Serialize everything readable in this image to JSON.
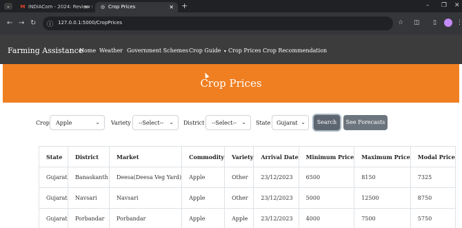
{
  "browser": {
    "tabs": [
      {
        "label": "INDIACom - 2024: Review Noti",
        "icon": "gmail-icon",
        "active": false
      },
      {
        "label": "Crop Prices",
        "icon": "globe-icon",
        "active": true
      }
    ],
    "url": "127.0.0.1:5000/CropPrices"
  },
  "navbar": {
    "brand": "Farming Assistance",
    "links": [
      "Home",
      "Weather",
      "Government Schemes",
      "Crop Guide",
      "Crop Prices",
      "Crop Recommendation"
    ]
  },
  "banner": {
    "title": "Crop Prices"
  },
  "filters": {
    "crop_label": "Crop",
    "crop_value": "Apple",
    "variety_label": "Variety",
    "variety_value": "--Select--",
    "district_label": "District",
    "district_value": "--Select--",
    "state_label": "State",
    "state_value": "Gujarat",
    "search_label": "Search",
    "forecast_label": "See Forecasts"
  },
  "table": {
    "headers": [
      "State",
      "District",
      "Market",
      "Commodity",
      "Variety",
      "Arrival Date",
      "Minimum Price",
      "Maximum Price",
      "Modal Price"
    ],
    "rows": [
      [
        "Gujarat",
        "Banaskanth",
        "Deesa(Deesa Veg Yard)",
        "Apple",
        "Other",
        "23/12/2023",
        "6500",
        "8150",
        "7325"
      ],
      [
        "Gujarat",
        "Navsari",
        "Navsari",
        "Apple",
        "Other",
        "23/12/2023",
        "5000",
        "12500",
        "8750"
      ],
      [
        "Gujarat",
        "Porbandar",
        "Porbandar",
        "Apple",
        "Apple",
        "23/12/2023",
        "4000",
        "7500",
        "5750"
      ]
    ]
  },
  "colors": {
    "banner": "#f07f22",
    "navbar": "#3c3c3c",
    "button": "#6c757d"
  }
}
